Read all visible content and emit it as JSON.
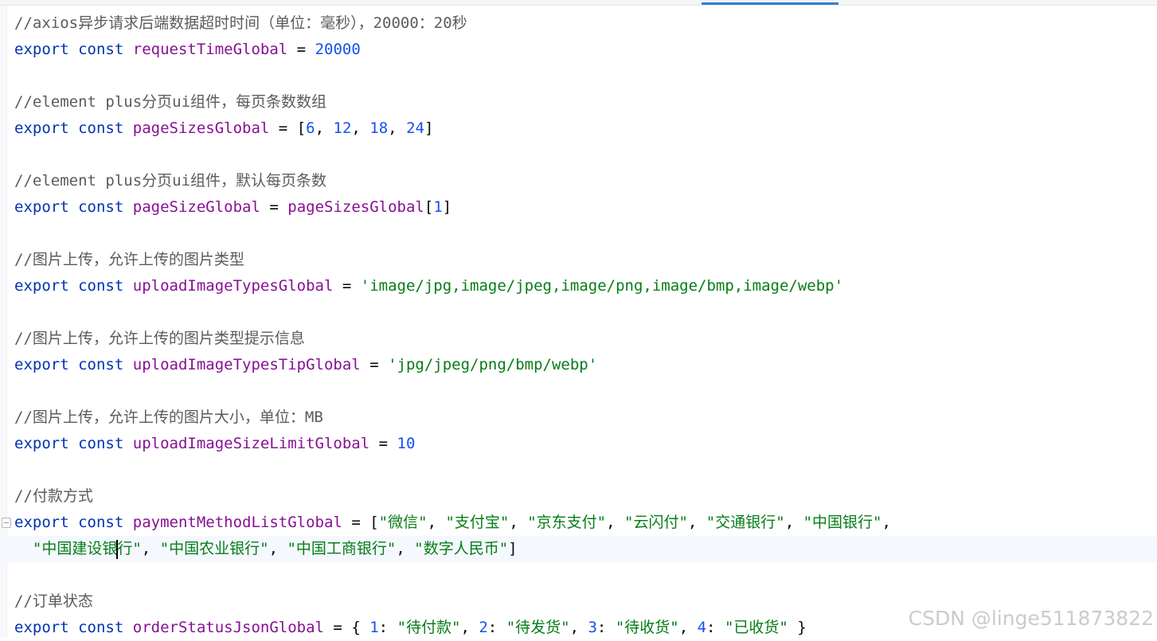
{
  "code": {
    "comment_timeout": "//axios异步请求后端数据超时时间（单位：毫秒），20000：20秒",
    "kw_export": "export",
    "kw_const": "const",
    "var_request_time": "requestTimeGlobal",
    "eq": "=",
    "val_request_time": "20000",
    "comment_page_sizes": "//element plus分页ui组件，每页条数数组",
    "var_page_sizes": "pageSizesGlobal",
    "page_sizes": [
      "6",
      "12",
      "18",
      "24"
    ],
    "comment_page_size": "//element plus分页ui组件，默认每页条数",
    "var_page_size": "pageSizeGlobal",
    "page_size_index": "1",
    "comment_upload_types": "//图片上传，允许上传的图片类型",
    "var_upload_types": "uploadImageTypesGlobal",
    "val_upload_types": "'image/jpg,image/jpeg,image/png,image/bmp,image/webp'",
    "comment_upload_tip": "//图片上传，允许上传的图片类型提示信息",
    "var_upload_tip": "uploadImageTypesTipGlobal",
    "val_upload_tip": "'jpg/jpeg/png/bmp/webp'",
    "comment_upload_size": "//图片上传，允许上传的图片大小，单位：MB",
    "var_upload_size": "uploadImageSizeLimitGlobal",
    "val_upload_size": "10",
    "comment_payment": "//付款方式",
    "var_payment": "paymentMethodListGlobal",
    "payment_methods_line1": [
      "\"微信\"",
      "\"支付宝\"",
      "\"京东支付\"",
      "\"云闪付\"",
      "\"交通银行\"",
      "\"中国银行\""
    ],
    "payment_methods_line2_a": "\"中国建设银",
    "payment_methods_line2_b": "行\"",
    "payment_methods_line2": [
      "\"中国农业银行\"",
      "\"中国工商银行\"",
      "\"数字人民币\""
    ],
    "comment_order": "//订单状态",
    "var_order": "orderStatusJsonGlobal",
    "order_status": [
      {
        "key": "1",
        "value": "\"待付款\""
      },
      {
        "key": "2",
        "value": "\"待发货\""
      },
      {
        "key": "3",
        "value": "\"待收货\""
      },
      {
        "key": "4",
        "value": "\"已收货\""
      }
    ]
  },
  "watermark": "CSDN @linge511873822",
  "colors": {
    "keyword": "#0033b3",
    "identifier": "#871094",
    "number": "#1750eb",
    "string": "#067d17",
    "comment": "#5b5b5b"
  }
}
